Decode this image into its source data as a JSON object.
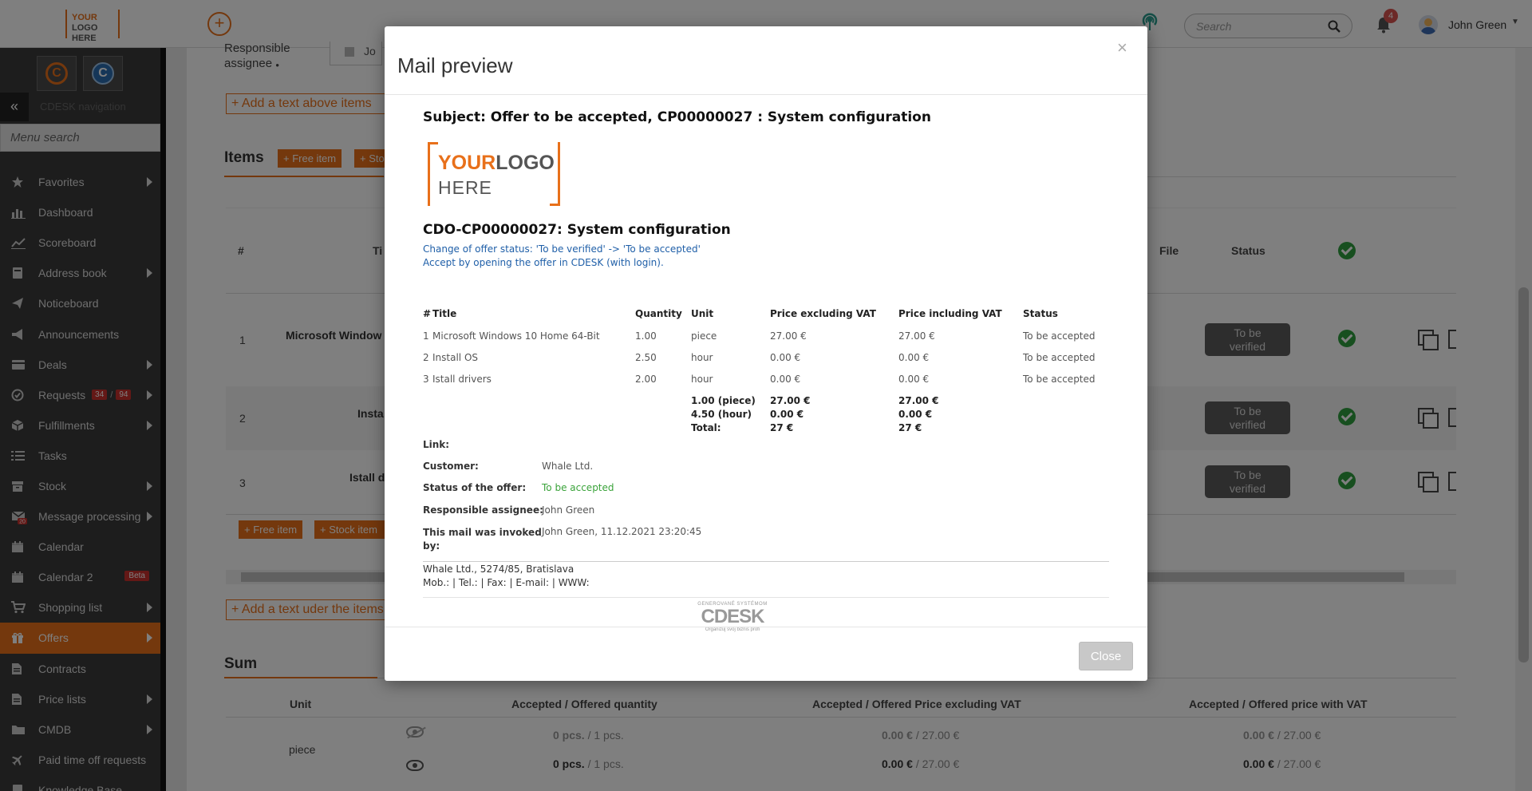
{
  "topbar": {
    "logo_line1_a": "YOUR",
    "logo_line1_b": "LOGO",
    "logo_line2": "HERE",
    "search_placeholder": "Search",
    "notification_count": "4",
    "user_name": "John Green"
  },
  "sidebar": {
    "nav_caption": "CDESK navigation",
    "menu_search_placeholder": "Menu search",
    "items": [
      {
        "label": "Favorites",
        "icon": "star-icon",
        "arrow": true
      },
      {
        "label": "Dashboard",
        "icon": "bar-chart-icon",
        "arrow": false
      },
      {
        "label": "Scoreboard",
        "icon": "line-chart-icon",
        "arrow": false
      },
      {
        "label": "Address book",
        "icon": "book-icon",
        "arrow": true
      },
      {
        "label": "Noticeboard",
        "icon": "paper-plane-icon",
        "arrow": false
      },
      {
        "label": "Announcements",
        "icon": "megaphone-icon",
        "arrow": false
      },
      {
        "label": "Deals",
        "icon": "card-icon",
        "arrow": true
      },
      {
        "label": "Requests",
        "icon": "check-circle-icon",
        "arrow": true,
        "badge1": "34",
        "badge2": "94"
      },
      {
        "label": "Fulfillments",
        "icon": "box-icon",
        "arrow": true
      },
      {
        "label": "Tasks",
        "icon": "list-icon",
        "arrow": false
      },
      {
        "label": "Stock",
        "icon": "archive-icon",
        "arrow": true
      },
      {
        "label": "Message processing",
        "icon": "envelope-icon",
        "arrow": true,
        "icon_badge": "20"
      },
      {
        "label": "Calendar",
        "icon": "calendar-icon",
        "arrow": false
      },
      {
        "label": "Calendar 2",
        "icon": "calendar-icon",
        "arrow": false,
        "beta": "Beta"
      },
      {
        "label": "Shopping list",
        "icon": "cart-icon",
        "arrow": true
      },
      {
        "label": "Offers",
        "icon": "gift-icon",
        "arrow": true,
        "active": true
      },
      {
        "label": "Contracts",
        "icon": "document-icon",
        "arrow": false
      },
      {
        "label": "Price lists",
        "icon": "document-icon",
        "arrow": true
      },
      {
        "label": "CMDB",
        "icon": "folder-icon",
        "arrow": true
      },
      {
        "label": "Paid time off requests",
        "icon": "plane-icon",
        "arrow": false
      },
      {
        "label": "Knowledge Base",
        "icon": "book-icon",
        "arrow": false
      }
    ]
  },
  "main": {
    "responsible_label_1": "Responsible",
    "responsible_label_2": "assignee",
    "assignee_value": "Jo",
    "add_text_above": "Add a text above items",
    "items_title": "Items",
    "free_item": "Free item",
    "stock_item": "Stock item",
    "stock_item_short": "Sto",
    "col_num": "#",
    "col_title": "Ti",
    "col_file": "File",
    "col_status": "Status",
    "rows": [
      {
        "num": "1",
        "title": "Microsoft Window",
        "status_1": "To be",
        "status_2": "verified"
      },
      {
        "num": "2",
        "title": "Insta",
        "status_1": "To be",
        "status_2": "verified"
      },
      {
        "num": "3",
        "title": "Istall d",
        "status_1": "To be",
        "status_2": "verified"
      }
    ],
    "add_text_under": "Add a text uder the items",
    "sum_title": "Sum",
    "sum_cols": [
      "Unit",
      "Accepted / Offered quantity",
      "Accepted / Offered Price excluding VAT",
      "Accepted / Offered price with VAT"
    ],
    "sum_unit": "piece",
    "sum_rows": [
      {
        "qty_a": "0 pcs.",
        "qty_b": " / 1 pcs.",
        "ex_a": "0.00 €",
        "ex_b": " / 27.00 €",
        "inc_a": "0.00 €",
        "inc_b": " / 27.00 €"
      },
      {
        "qty_a": "0 pcs.",
        "qty_b": " / 1 pcs.",
        "ex_a": "0.00 €",
        "ex_b": " / 27.00 €",
        "inc_a": "0.00 €",
        "inc_b": " / 27.00 €"
      }
    ]
  },
  "modal": {
    "title": "Mail preview",
    "close_x": "×",
    "close_button": "Close",
    "mail": {
      "subject": "Subject: Offer to be accepted, CP00000027 : System configuration",
      "logo_your": "YOUR",
      "logo_logo": "LOGO",
      "logo_here": "HERE",
      "heading": "CDO-CP00000027: System configuration",
      "status_change": "Change of offer status: 'To be verified' -> 'To be accepted'",
      "accept_note": "Accept by opening the offer in CDESK (with login).",
      "table_headers": [
        "#",
        "Title",
        "Quantity",
        "Unit",
        "Price excluding VAT",
        "Price including VAT",
        "Status"
      ],
      "table_rows": [
        {
          "num": "1",
          "title": "Microsoft Windows 10 Home 64-Bit",
          "qty": "1.00",
          "unit": "piece",
          "ex": "27.00 €",
          "inc": "27.00 €",
          "status": "To be accepted"
        },
        {
          "num": "2",
          "title": "Install OS",
          "qty": "2.50",
          "unit": "hour",
          "ex": "0.00 €",
          "inc": "0.00 €",
          "status": "To be accepted"
        },
        {
          "num": "3",
          "title": "Istall drivers",
          "qty": "2.00",
          "unit": "hour",
          "ex": "0.00 €",
          "inc": "0.00 €",
          "status": "To be accepted"
        }
      ],
      "totals": {
        "unit_1": "1.00 (piece)",
        "unit_2": "4.50 (hour)",
        "total_label": "Total:",
        "ex_1": "27.00 €",
        "ex_2": "0.00 €",
        "ex_total": "27 €",
        "inc_1": "27.00 €",
        "inc_2": "0.00 €",
        "inc_total": "27 €"
      },
      "link_label": "Link:",
      "customer_label": "Customer:",
      "customer_value": "Whale Ltd.",
      "status_label": "Status of the offer:",
      "status_value": "To be accepted",
      "responsible_label": "Responsible assignee:",
      "responsible_value": "John Green",
      "invoked_label_1": "This mail was invoked",
      "invoked_label_2": "by:",
      "invoked_value": "John Green, 11.12.2021 23:20:45",
      "footer_address": "Whale Ltd., 5274/85, Bratislava",
      "footer_contacts": "Mob.: | Tel.: | Fax: | E-mail: | WWW:",
      "cdesk_small": "GENEROVANÉ SYSTÉMOM",
      "cdesk_brand": "CDESK",
      "cdesk_tagline": "Organizuj svoj biznis profi"
    }
  },
  "colors": {
    "accent": "#e8701a",
    "sidebar_bg": "#3b3b3b",
    "success": "#2e9e3e",
    "link_blue": "#1f5fa8",
    "status_green": "#3aa33a"
  }
}
